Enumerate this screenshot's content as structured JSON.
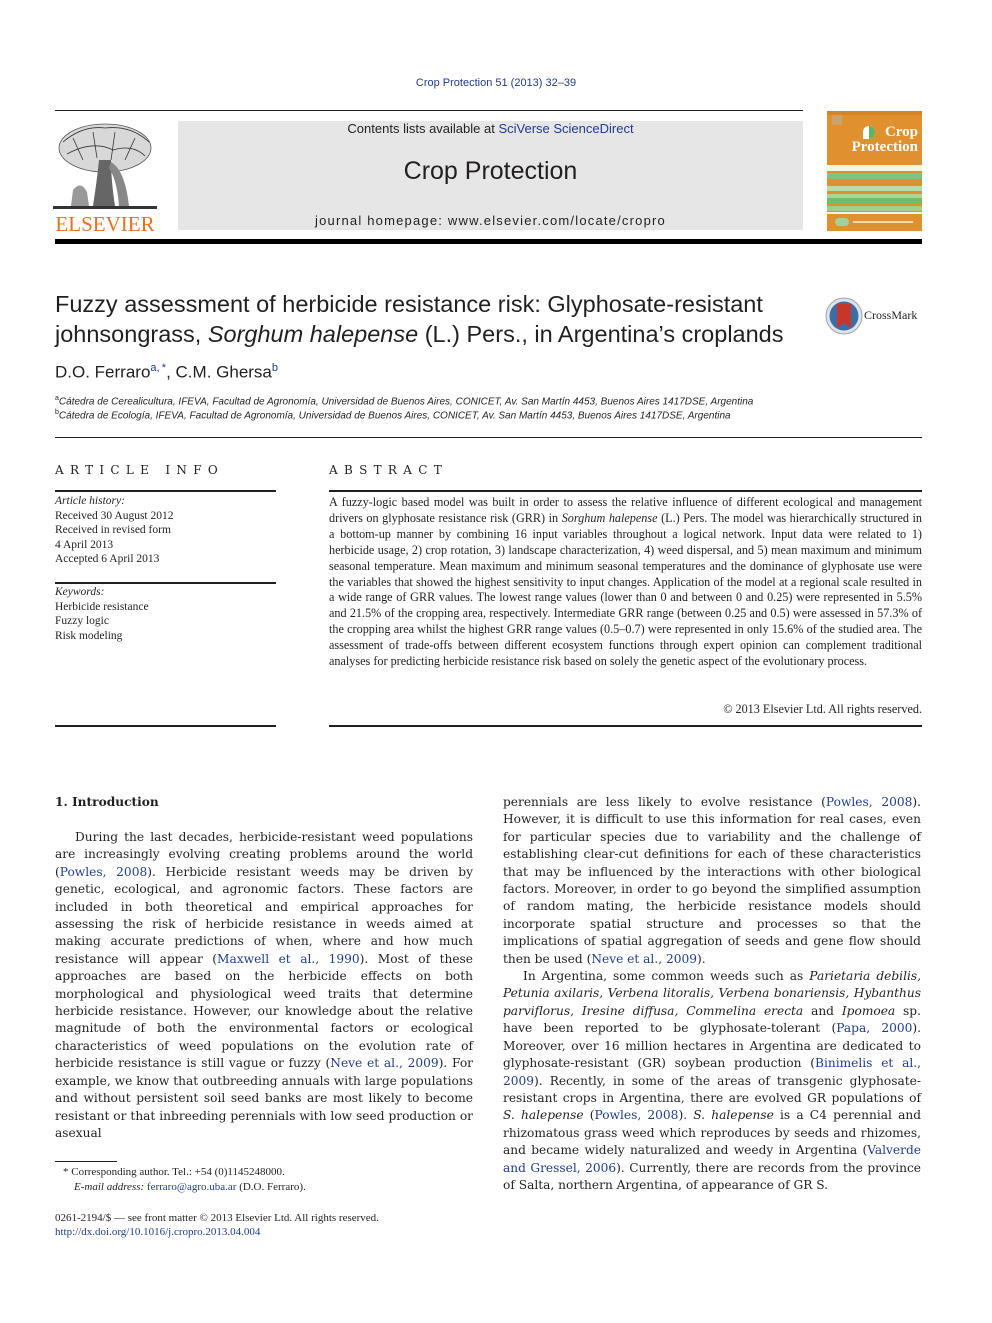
{
  "header": {
    "citation": "Crop Protection 51 (2013) 32–39",
    "contents_prefix": "Contents lists available at ",
    "contents_link": "SciVerse ScienceDirect",
    "journal_title": "Crop Protection",
    "homepage_prefix": "journal homepage: ",
    "homepage_url": "www.elsevier.com/locate/cropro",
    "publisher_logo_icon": "elsevier-tree-logo",
    "publisher_name": "ELSEVIER",
    "cover_title_line1": "Crop",
    "cover_title_line2": "Protection",
    "crossmark_label": "CrossMark",
    "colors": {
      "link": "#1f3d8c",
      "elsevier_orange": "#e9711c",
      "cover_orange": "#e0902e",
      "cover_green": "#7cc47f",
      "masthead_gray": "#e6e6e6"
    }
  },
  "article": {
    "title_part1": "Fuzzy assessment of herbicide resistance risk: Glyphosate-resistant johnsongrass, ",
    "title_italic": "Sorghum halepense",
    "title_part2": " (L.) Pers., in Argentina’s croplands",
    "authors": [
      {
        "name": "D.O. Ferraro",
        "sup": "a, *"
      },
      {
        "name": "C.M. Ghersa",
        "sup": "b"
      }
    ],
    "author_separator": ", ",
    "affiliations": [
      {
        "sup": "a",
        "text": "Cátedra de Cerealicultura, IFEVA, Facultad de Agronomía, Universidad de Buenos Aires, CONICET, Av. San Martín 4453, Buenos Aires 1417DSE, Argentina"
      },
      {
        "sup": "b",
        "text": "Cátedra de Ecología, IFEVA, Facultad de Agronomía, Universidad de Buenos Aires, CONICET, Av. San Martín 4453, Buenos Aires 1417DSE, Argentina"
      }
    ]
  },
  "article_info": {
    "heading": "ARTICLE INFO",
    "history_label": "Article history:",
    "history": [
      "Received 30 August 2012",
      "Received in revised form",
      "4 April 2013",
      "Accepted 6 April 2013"
    ],
    "keywords_label": "Keywords:",
    "keywords": [
      "Herbicide resistance",
      "Fuzzy logic",
      "Risk modeling"
    ]
  },
  "abstract": {
    "heading": "ABSTRACT",
    "text_part1": "A fuzzy-logic based model was built in order to assess the relative influence of different ecological and management drivers on glyphosate resistance risk (GRR) in ",
    "text_italic": "Sorghum halepense",
    "text_part2": " (L.) Pers. The model was hierarchically structured in a bottom-up manner by combining 16 input variables throughout a logical network. Input data were related to 1) herbicide usage, 2) crop rotation, 3) landscape characterization, 4) weed dispersal, and 5) mean maximum and minimum seasonal temperature. Mean maximum and minimum seasonal temperatures and the dominance of glyphosate use were the variables that showed the highest sensitivity to input changes. Application of the model at a regional scale resulted in a wide range of GRR values. The lowest range values (lower than 0 and between 0 and 0.25) were represented in 5.5% and 21.5% of the cropping area, respectively. Intermediate GRR range (between 0.25 and 0.5) were assessed in 57.3% of the cropping area whilst the highest GRR range values (0.5–0.7) were represented in only 15.6% of the studied area. The assessment of trade-offs between different ecosystem functions through expert opinion can complement traditional analyses for predicting herbicide resistance risk based on solely the genetic aspect of the evolutionary process.",
    "copyright": "© 2013 Elsevier Ltd. All rights reserved."
  },
  "intro": {
    "heading": "1.  Introduction",
    "left": {
      "p1_a": "During the last decades, herbicide-resistant weed populations are increasingly evolving creating problems around the world (",
      "p1_ref1": "Powles, 2008",
      "p1_b": "). Herbicide resistant weeds may be driven by genetic, ecological, and agronomic factors. These factors are included in both theoretical and empirical approaches for assessing the risk of herbicide resistance in weeds aimed at making accurate predictions of when, where and how much resistance will appear (",
      "p1_ref2": "Maxwell et al., 1990",
      "p1_c": "). Most of these approaches are based on the herbicide effects on both morphological and physiological weed traits that determine herbicide resistance. However, our knowledge about the relative magnitude of both the environmental factors or ecological characteristics of weed populations on the evolution rate of herbicide resistance is still vague or fuzzy (",
      "p1_ref3": "Neve et al., 2009",
      "p1_d": "). For example, we know that outbreeding annuals with large populations and without persistent soil seed banks are most likely to become resistant or that inbreeding perennials with low seed production or asexual"
    },
    "right": {
      "p1_a": "perennials are less likely to evolve resistance (",
      "p1_ref1": "Powles, 2008",
      "p1_b": "). However, it is difficult to use this information for real cases, even for particular species due to variability and the challenge of establishing clear-cut definitions for each of these characteristics that may be influenced by the interactions with other biological factors. Moreover, in order to go beyond the simplified assumption of random mating, the herbicide resistance models should incorporate spatial structure and processes so that the implications of spatial aggregation of seeds and gene flow should then be used (",
      "p1_ref2": "Neve et al., 2009",
      "p1_c": ").",
      "p2_a": "In Argentina, some common weeds such as ",
      "p2_species1": "Parietaria debilis, Petunia axilaris, Verbena litoralis, Verbena bonariensis, Hybanthus parviflorus, Iresine diffusa, Commelina erecta",
      "p2_and": " and ",
      "p2_species2": "Ipomoea",
      "p2_b": " sp. have been reported to be glyphosate-tolerant (",
      "p2_ref1": "Papa, 2000",
      "p2_c": "). Moreover, over 16 million hectares in Argentina are dedicated to glyphosate-resistant (GR) soybean production (",
      "p2_ref2": "Binimelis et al., 2009",
      "p2_d": "). Recently, in some of the areas of transgenic glyphosate-resistant crops in Argentina, there are evolved GR populations of ",
      "p2_species3": "S. halepense",
      "p2_e": " (",
      "p2_ref3": "Powles, 2008",
      "p2_f": "). ",
      "p2_species4": "S. halepense",
      "p2_g": " is a C4 perennial and rhizomatous grass weed which reproduces by seeds and rhizomes, and became widely naturalized and weedy in Argentina (",
      "p2_ref4": "Valverde and Gressel, 2006",
      "p2_h": "). Currently, there are records from the province of Salta, northern Argentina, of appearance of GR S."
    }
  },
  "footnotes": {
    "corresponding": "*  Corresponding author. Tel.: +54 (0)1145248000.",
    "email_label": "E-mail address: ",
    "email": "ferraro@agro.uba.ar",
    "email_suffix": " (D.O. Ferraro).",
    "issn": "0261-2194/$ — see front matter © 2013 Elsevier Ltd. All rights reserved.",
    "doi": "http://dx.doi.org/10.1016/j.cropro.2013.04.004"
  }
}
